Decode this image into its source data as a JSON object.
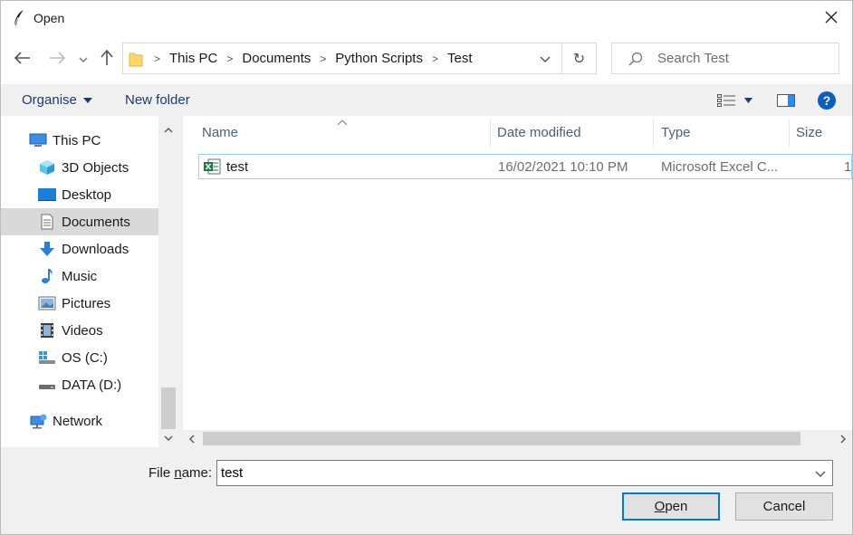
{
  "window": {
    "title": "Open",
    "feather_icon": "feather-icon",
    "close_icon": "close-icon"
  },
  "address_bar": {
    "crumbs": [
      "This PC",
      "Documents",
      "Python Scripts",
      "Test"
    ],
    "separator": ">",
    "refresh_glyph": "↻"
  },
  "search": {
    "placeholder": "Search Test"
  },
  "toolbar": {
    "organise_label": "Organise",
    "new_folder_label": "New folder",
    "help_glyph": "?"
  },
  "nav_pane": {
    "items": [
      {
        "label": "This PC",
        "icon": "this-pc-icon"
      },
      {
        "label": "3D Objects",
        "icon": "3d-objects-icon"
      },
      {
        "label": "Desktop",
        "icon": "desktop-icon"
      },
      {
        "label": "Documents",
        "icon": "documents-icon",
        "selected": true
      },
      {
        "label": "Downloads",
        "icon": "downloads-icon"
      },
      {
        "label": "Music",
        "icon": "music-icon"
      },
      {
        "label": "Pictures",
        "icon": "pictures-icon"
      },
      {
        "label": "Videos",
        "icon": "videos-icon"
      },
      {
        "label": "OS (C:)",
        "icon": "os-drive-icon"
      },
      {
        "label": "DATA (D:)",
        "icon": "data-drive-icon"
      },
      {
        "label": "Network",
        "icon": "network-icon"
      }
    ]
  },
  "columns": [
    "Name",
    "Date modified",
    "Type",
    "Size"
  ],
  "files": [
    {
      "name": "test",
      "date_modified": "16/02/2021 10:10 PM",
      "type": "Microsoft Excel C...",
      "size": "1",
      "icon": "excel-csv-icon"
    }
  ],
  "bottom": {
    "file_name_label_pre": "File ",
    "file_name_label_u": "n",
    "file_name_label_post": "ame:",
    "file_name_value": "test",
    "open_u": "O",
    "open_rest": "pen",
    "cancel_label": "Cancel"
  },
  "colors": {
    "accent": "#0078d7",
    "selection_border": "#99d1ff",
    "selected_nav_bg": "#d9d9d9",
    "link_text": "#1e3a6e"
  }
}
